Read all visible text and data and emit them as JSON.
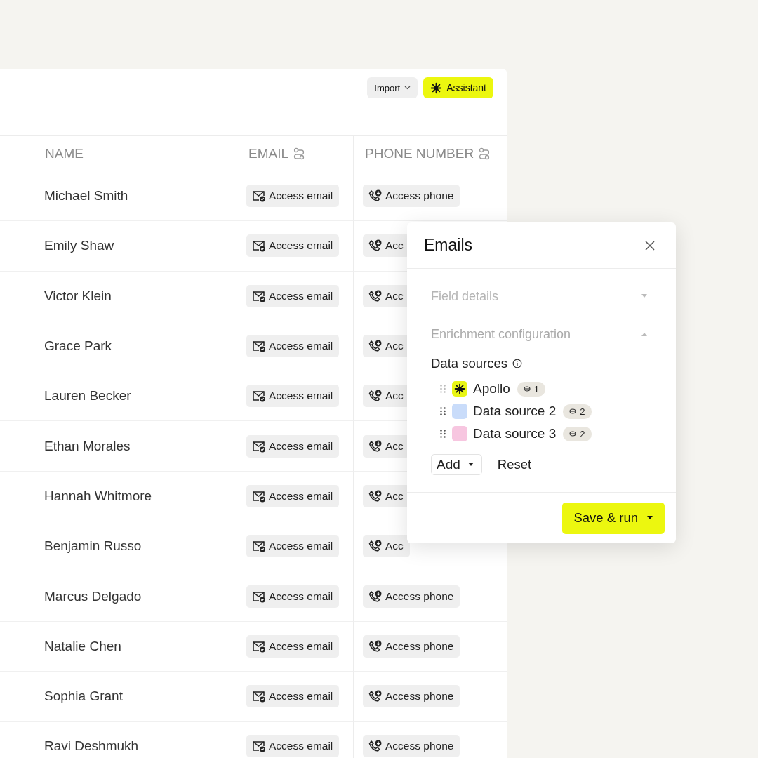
{
  "toolbar": {
    "buttons": [
      {
        "label": "Import",
        "kind": "dropdown"
      },
      {
        "label": "Assistant",
        "kind": "primary"
      }
    ]
  },
  "table": {
    "columns": [
      {
        "label": "NAME",
        "icon": false
      },
      {
        "label": "EMAIL",
        "icon": true
      },
      {
        "label": "PHONE NUMBER",
        "icon": true
      }
    ],
    "rows": [
      {
        "name": "Michael Smith",
        "email": "Access email",
        "phone": "Access phone"
      },
      {
        "name": "Emily Shaw",
        "email": "Access email",
        "phone": "Acc"
      },
      {
        "name": "Victor Klein",
        "email": "Access email",
        "phone": "Acc"
      },
      {
        "name": "Grace Park",
        "email": "Access email",
        "phone": "Acc"
      },
      {
        "name": "Lauren Becker",
        "email": "Access email",
        "phone": "Acc"
      },
      {
        "name": "Ethan Morales",
        "email": "Access email",
        "phone": "Acc"
      },
      {
        "name": "Hannah Whitmore",
        "email": "Access email",
        "phone": "Acc"
      },
      {
        "name": "Benjamin Russo",
        "email": "Access email",
        "phone": "Acc"
      },
      {
        "name": "Marcus Delgado",
        "email": "Access email",
        "phone": "Access phone"
      },
      {
        "name": "Natalie Chen",
        "email": "Access email",
        "phone": "Access phone"
      },
      {
        "name": "Sophia Grant",
        "email": "Access email",
        "phone": "Access phone"
      },
      {
        "name": "Ravi Deshmukh",
        "email": "Access email",
        "phone": "Access phone"
      }
    ]
  },
  "panel": {
    "title": "Emails",
    "sections": [
      {
        "label": "Field details",
        "expanded": false
      },
      {
        "label": "Enrichment configuration",
        "expanded": true
      }
    ],
    "data_sources": {
      "title": "Data sources",
      "items": [
        {
          "name": "Apollo",
          "count": "1",
          "color": "#e8f514"
        },
        {
          "name": "Data source 2",
          "count": "2",
          "color": "#c9dcfa"
        },
        {
          "name": "Data source 3",
          "count": "2",
          "color": "#f7c6e0"
        }
      ]
    },
    "actions": [
      "Add",
      "Reset"
    ],
    "submit": "Save & run"
  }
}
